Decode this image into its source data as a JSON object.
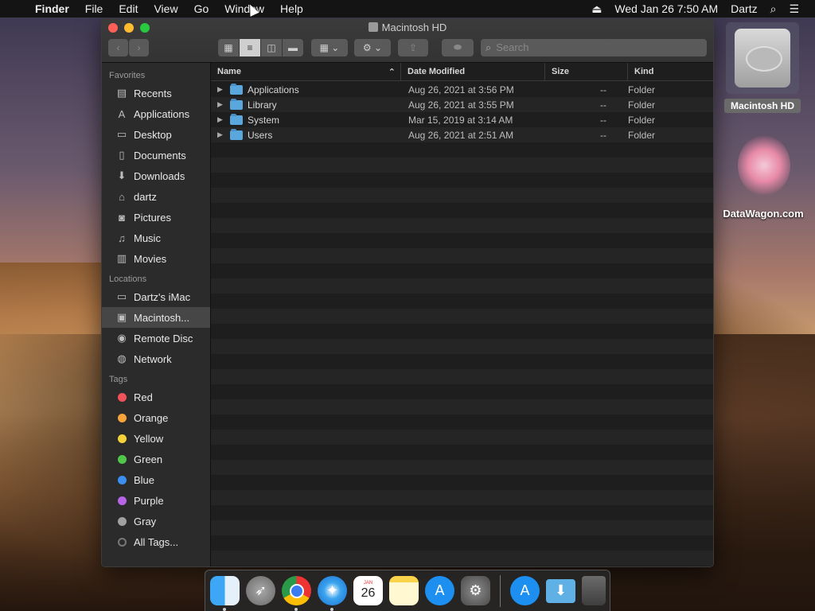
{
  "menubar": {
    "app_name": "Finder",
    "menus": [
      "File",
      "Edit",
      "View",
      "Go",
      "Window",
      "Help"
    ],
    "clock": "Wed Jan 26  7:50 AM",
    "user": "Dartz"
  },
  "window": {
    "title": "Macintosh HD",
    "search_placeholder": "Search"
  },
  "sidebar": {
    "favorites_header": "Favorites",
    "favorites": [
      {
        "label": "Recents",
        "icon": "recents-icon"
      },
      {
        "label": "Applications",
        "icon": "applications-icon"
      },
      {
        "label": "Desktop",
        "icon": "desktop-icon"
      },
      {
        "label": "Documents",
        "icon": "documents-icon"
      },
      {
        "label": "Downloads",
        "icon": "downloads-icon"
      },
      {
        "label": "dartz",
        "icon": "home-icon"
      },
      {
        "label": "Pictures",
        "icon": "camera-icon"
      },
      {
        "label": "Music",
        "icon": "music-note-icon"
      },
      {
        "label": "Movies",
        "icon": "film-icon"
      }
    ],
    "locations_header": "Locations",
    "locations": [
      {
        "label": "Dartz's iMac",
        "icon": "imac-icon"
      },
      {
        "label": "Macintosh...",
        "icon": "hard-drive-icon"
      },
      {
        "label": "Remote Disc",
        "icon": "disc-icon"
      },
      {
        "label": "Network",
        "icon": "globe-icon"
      }
    ],
    "tags_header": "Tags",
    "tags": [
      {
        "label": "Red",
        "color": "#f0525a"
      },
      {
        "label": "Orange",
        "color": "#f6a33a"
      },
      {
        "label": "Yellow",
        "color": "#f4d33a"
      },
      {
        "label": "Green",
        "color": "#4fc84a"
      },
      {
        "label": "Blue",
        "color": "#3b8ff0"
      },
      {
        "label": "Purple",
        "color": "#b764e6"
      },
      {
        "label": "Gray",
        "color": "#a0a0a0"
      },
      {
        "label": "All Tags...",
        "color": ""
      }
    ]
  },
  "list": {
    "columns": {
      "name": "Name",
      "date": "Date Modified",
      "size": "Size",
      "kind": "Kind"
    },
    "rows": [
      {
        "name": "Applications",
        "date": "Aug 26, 2021 at 3:56 PM",
        "size": "--",
        "kind": "Folder"
      },
      {
        "name": "Library",
        "date": "Aug 26, 2021 at 3:55 PM",
        "size": "--",
        "kind": "Folder"
      },
      {
        "name": "System",
        "date": "Mar 15, 2019 at 3:14 AM",
        "size": "--",
        "kind": "Folder"
      },
      {
        "name": "Users",
        "date": "Aug 26, 2021 at 2:51 AM",
        "size": "--",
        "kind": "Folder"
      }
    ]
  },
  "desktop": {
    "hd_label": "Macintosh HD",
    "logo_label": "DataWagon.com"
  },
  "dock": {
    "calendar_month": "JAN",
    "calendar_day": "26"
  }
}
